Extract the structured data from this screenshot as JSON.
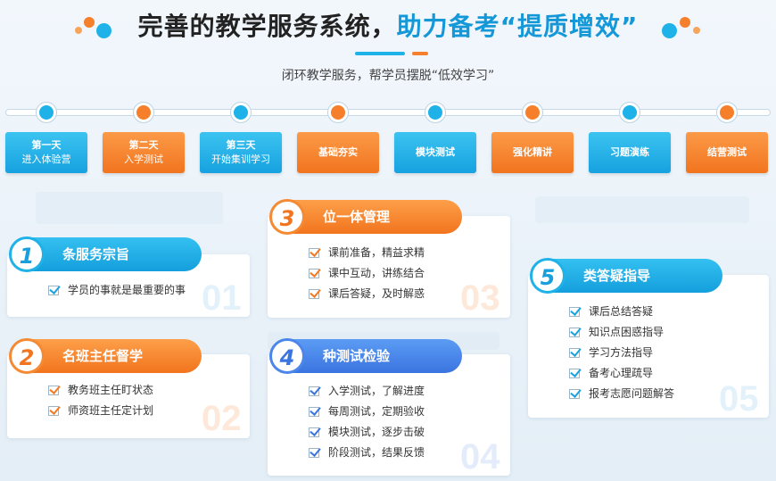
{
  "header": {
    "title_part1": "完善的教学服务系统，",
    "title_part2": "助力备考“提质增效”",
    "subtitle": "闭环教学服务，帮学员摆脱“低效学习”"
  },
  "timeline": [
    {
      "line1": "第一天",
      "line2": "进入体验营",
      "color": "blue"
    },
    {
      "line1": "第二天",
      "line2": "入学测试",
      "color": "orange"
    },
    {
      "line1": "第三天",
      "line2": "开始集训学习",
      "color": "blue"
    },
    {
      "line1": "基础夯实",
      "line2": "",
      "color": "orange"
    },
    {
      "line1": "模块测试",
      "line2": "",
      "color": "blue"
    },
    {
      "line1": "强化精讲",
      "line2": "",
      "color": "orange"
    },
    {
      "line1": "习题演练",
      "line2": "",
      "color": "blue"
    },
    {
      "line1": "结营测试",
      "line2": "",
      "color": "orange"
    }
  ],
  "cards": [
    {
      "num": "1",
      "title": "条服务宗旨",
      "watermark": "01",
      "items": [
        "学员的事就是最重要的事"
      ]
    },
    {
      "num": "2",
      "title": "名班主任督学",
      "watermark": "02",
      "items": [
        "教务班主任盯状态",
        "师资班主任定计划"
      ]
    },
    {
      "num": "3",
      "title": "位一体管理",
      "watermark": "03",
      "items": [
        "课前准备，精益求精",
        "课中互动，讲练结合",
        "课后答疑，及时解惑"
      ]
    },
    {
      "num": "4",
      "title": "种测试检验",
      "watermark": "04",
      "items": [
        "入学测试，了解进度",
        "每周测试，定期验收",
        "模块测试，逐步击破",
        "阶段测试，结果反馈"
      ]
    },
    {
      "num": "5",
      "title": "类答疑指导",
      "watermark": "05",
      "items": [
        "课后总结答疑",
        "知识点困惑指导",
        "学习方法指导",
        "备考心理疏导",
        "报考志愿问题解答"
      ]
    }
  ],
  "colors": {
    "blue": "#1fb2e8",
    "orange": "#f57f2a",
    "indigo": "#3a74e0",
    "title_accent": "#1598d8"
  }
}
